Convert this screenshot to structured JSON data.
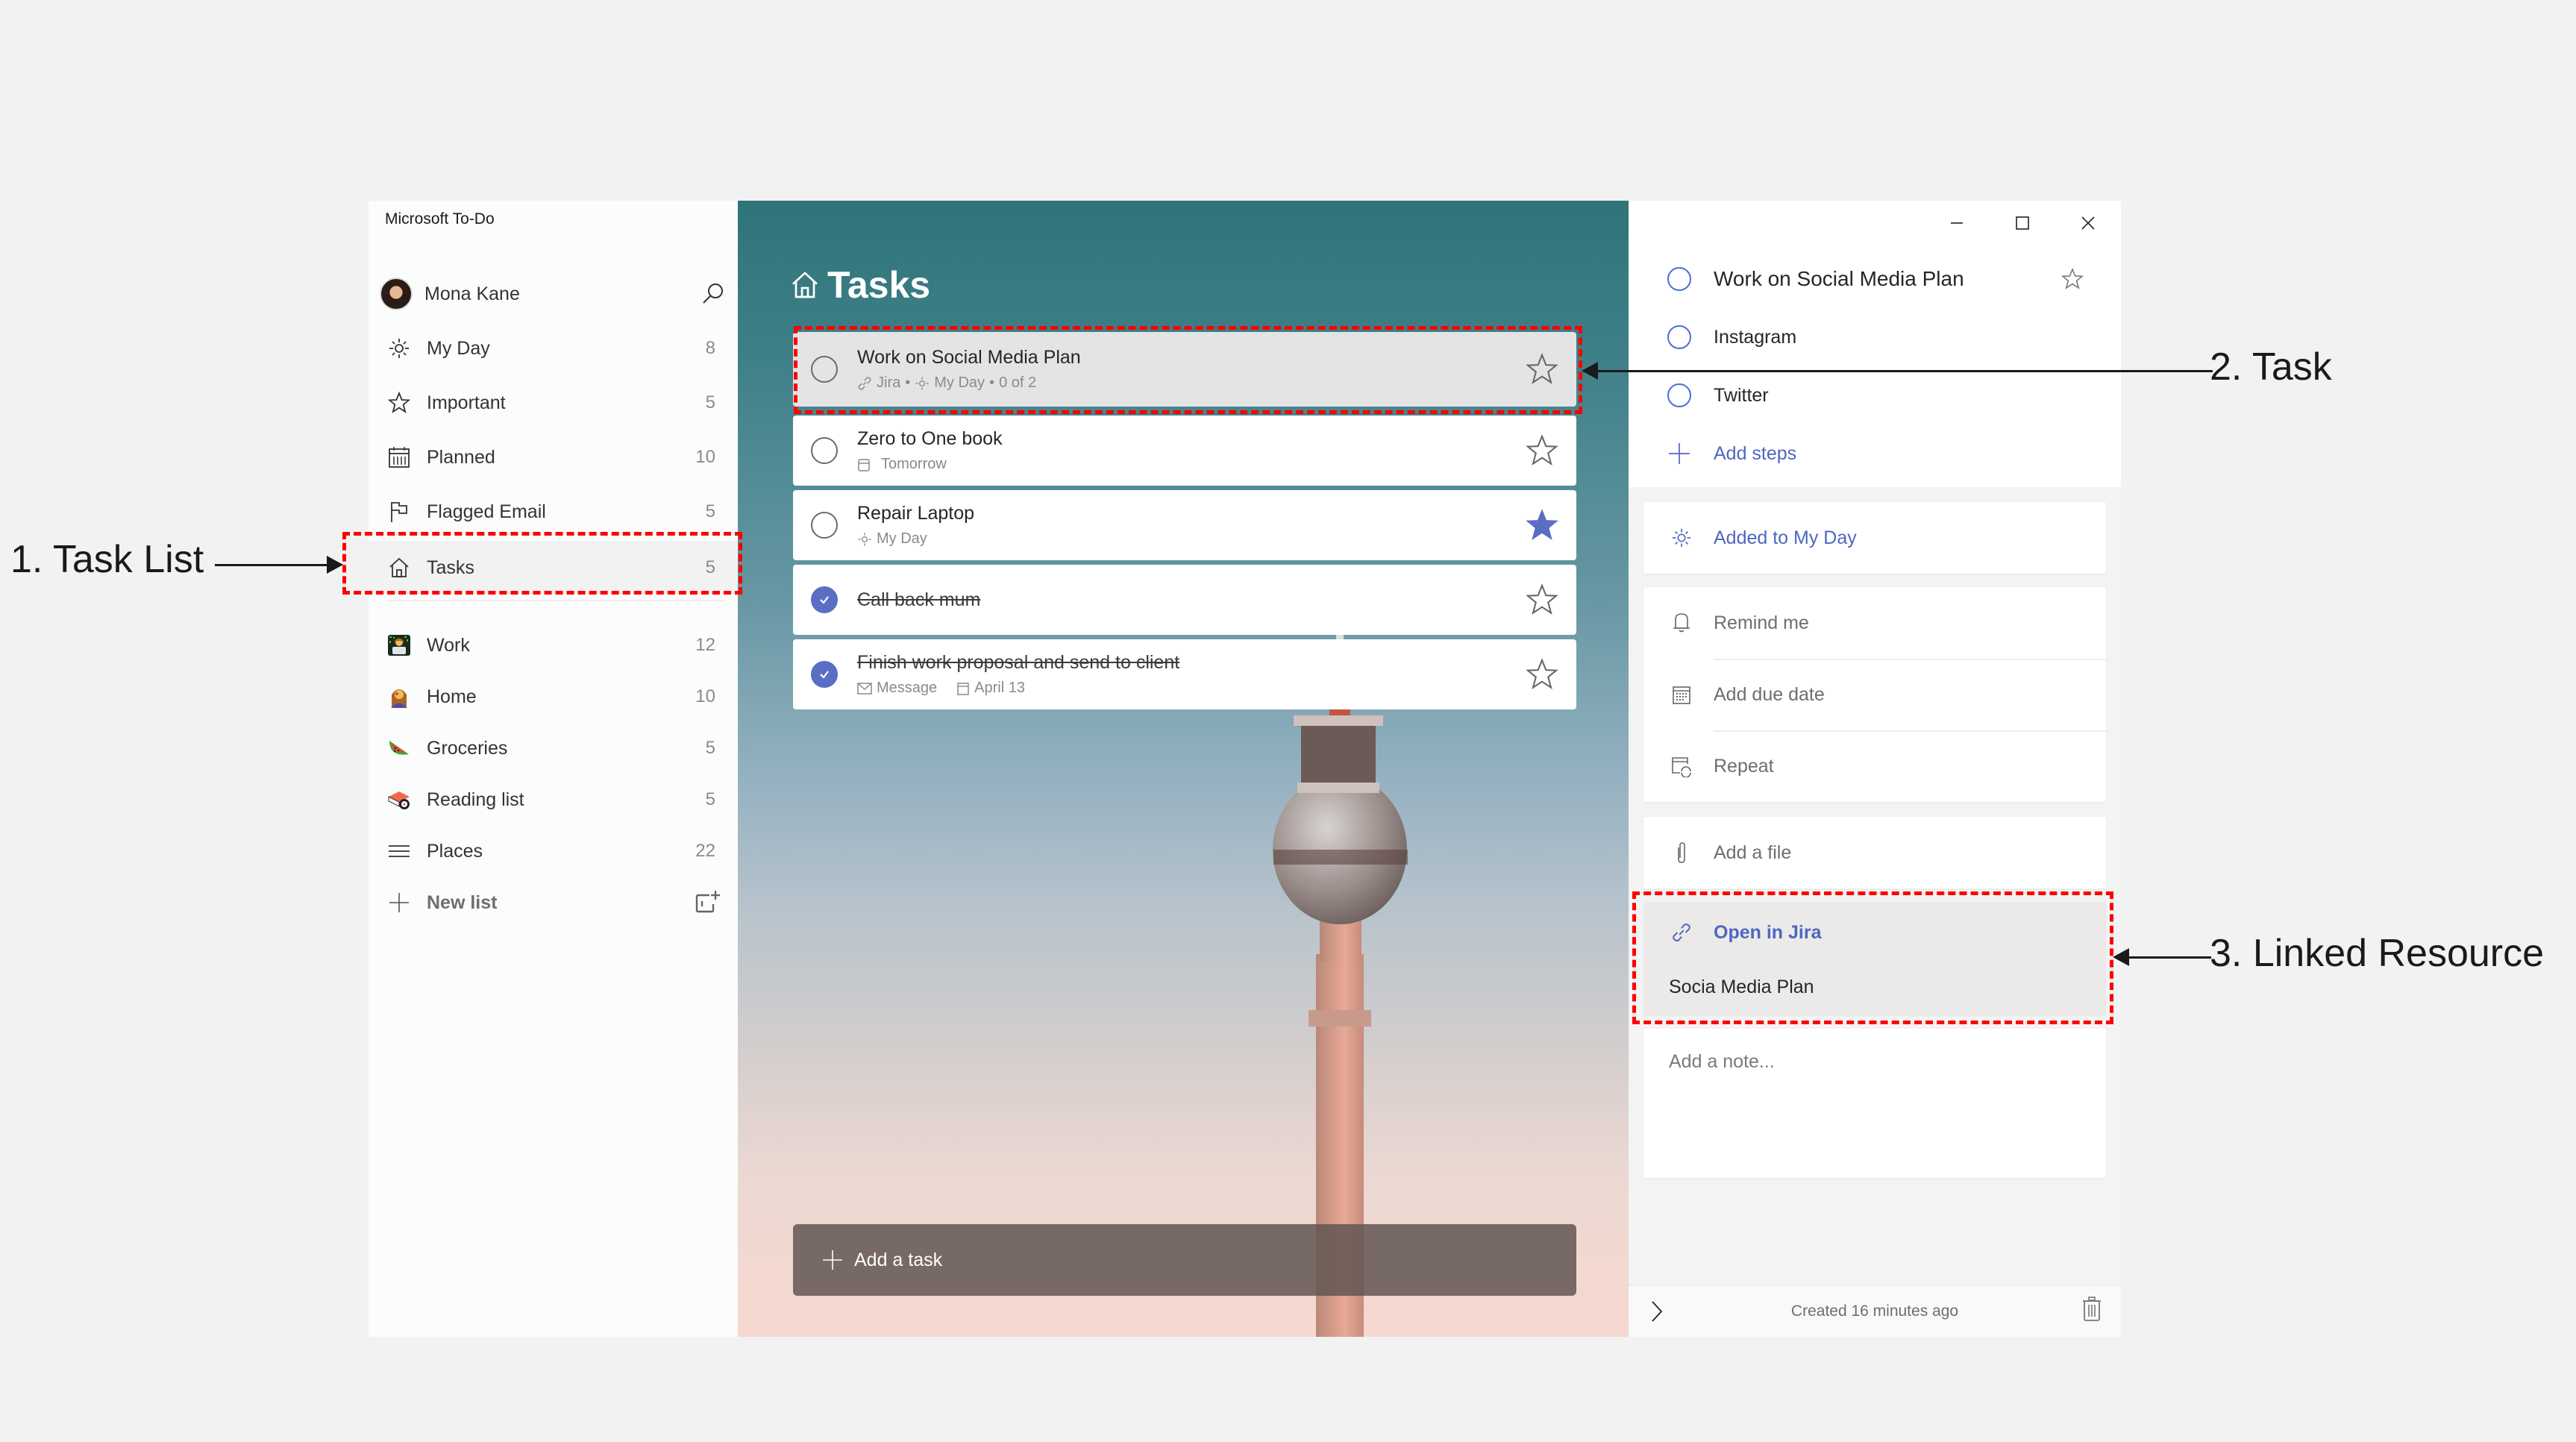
{
  "app": {
    "title": "Microsoft To-Do"
  },
  "user": {
    "name": "Mona Kane",
    "search_icon": "search-icon"
  },
  "sidebar": {
    "items": [
      {
        "icon": "sun-icon",
        "label": "My Day",
        "count": "8"
      },
      {
        "icon": "star-icon",
        "label": "Important",
        "count": "5"
      },
      {
        "icon": "calendar-icon",
        "label": "Planned",
        "count": "10"
      },
      {
        "icon": "flag-icon",
        "label": "Flagged Email",
        "count": "5"
      },
      {
        "icon": "home-icon",
        "label": "Tasks",
        "count": "5",
        "selected": true
      }
    ],
    "lists": [
      {
        "icon": "technologist-emoji",
        "label": "Work",
        "count": "12"
      },
      {
        "icon": "woman-emoji",
        "label": "Home",
        "count": "10"
      },
      {
        "icon": "watermelon-emoji",
        "label": "Groceries",
        "count": "5"
      },
      {
        "icon": "sushi-emoji",
        "label": "Reading list",
        "count": "5"
      },
      {
        "icon": "lines-icon",
        "label": "Places",
        "count": "22"
      }
    ],
    "new_list_label": "New list"
  },
  "main": {
    "title": "Tasks",
    "tasks": [
      {
        "title": "Work on Social Media Plan",
        "done": false,
        "important": false,
        "selected": true,
        "meta": {
          "link": "Jira",
          "my_day": "My Day",
          "steps": "0 of 2"
        }
      },
      {
        "title": "Zero to One book",
        "done": false,
        "important": false,
        "meta": {
          "due": "Tomorrow"
        }
      },
      {
        "title": "Repair Laptop",
        "done": false,
        "important": true,
        "meta": {
          "my_day": "My Day"
        }
      },
      {
        "title": "Call back mum",
        "done": true,
        "important": false,
        "meta": {}
      },
      {
        "title": "Finish work proposal and send to client",
        "done": true,
        "important": false,
        "meta": {
          "message": "Message",
          "due": "April 13"
        }
      }
    ],
    "add_task_label": "Add a task"
  },
  "detail": {
    "title": "Work on Social Media Plan",
    "steps": [
      "Instagram",
      "Twitter"
    ],
    "add_steps_label": "Add steps",
    "my_day_label": "Added to My Day",
    "remind_label": "Remind me",
    "due_label": "Add due date",
    "repeat_label": "Repeat",
    "file_label": "Add a file",
    "linked": {
      "action": "Open in Jira",
      "name": "Socia Media Plan"
    },
    "note_placeholder": "Add a note...",
    "footer": "Created 16 minutes ago"
  },
  "annotations": {
    "task_list": "1. Task List",
    "task": "2. Task",
    "linked_resource": "3. Linked Resource"
  },
  "colors": {
    "accent": "#5066c0",
    "checked": "#5a6fc4",
    "annotation_box": "#ff0000"
  }
}
